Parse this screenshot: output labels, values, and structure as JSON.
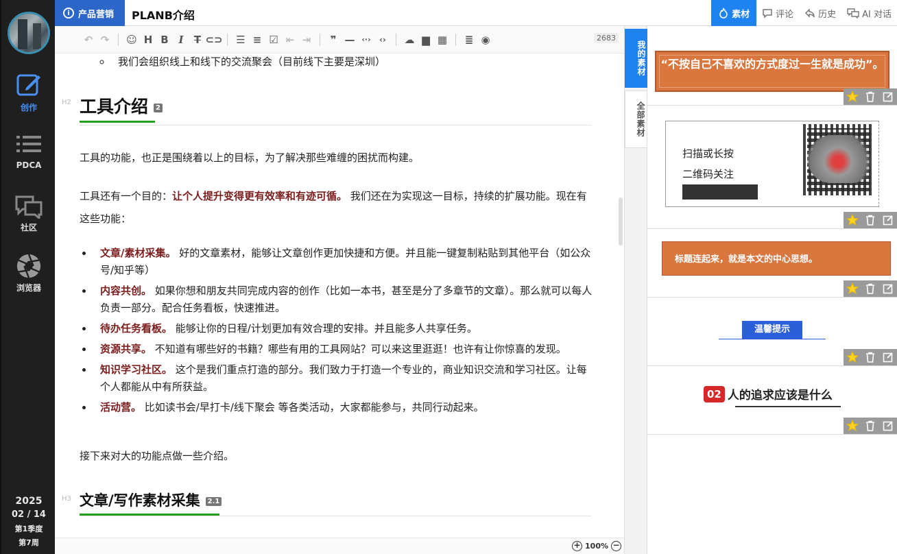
{
  "sidebar": {
    "nav": [
      {
        "label": "创作",
        "icon": "edit-icon"
      },
      {
        "label": "PDCA",
        "icon": "list-icon"
      },
      {
        "label": "社区",
        "icon": "chat-icon"
      },
      {
        "label": "浏览器",
        "icon": "aperture-icon"
      }
    ],
    "date": {
      "year": "2025",
      "month_day": "02 / 14",
      "quarter": "第1季度",
      "week": "第7周"
    }
  },
  "topbar": {
    "crumb": "产品营销",
    "title": "PLANB介绍",
    "tabs": [
      {
        "label": "素材",
        "icon": "fire-icon"
      },
      {
        "label": "评论",
        "icon": "comment-icon"
      },
      {
        "label": "历史",
        "icon": "history-icon"
      },
      {
        "label": "AI 对话",
        "icon": "ai-chat-icon"
      }
    ]
  },
  "toolbar": {
    "word_count": "2683"
  },
  "editor": {
    "top_bullet": "我们会组织线上和线下的交流聚会（目前线下主要是深圳）",
    "h2": {
      "mark": "H2",
      "title": "工具介绍",
      "num": "2"
    },
    "p1": "工具的功能，也正是围绕着以上的目标，为了解决那些难缠的困扰而构建。",
    "p2_pre": "工具还有一个目的：",
    "p2_bold": "让个人提升变得更有效率和有迹可循。",
    "p2_post": " 我们还在为实现这一目标，持续的扩展功能。现在有这些功能：",
    "features": [
      {
        "name": "文章/素材采集。",
        "desc": " 好的文章素材，能够让文章创作更加快捷和方便。并且能一键复制粘贴到其他平台（如公众号/知乎等）"
      },
      {
        "name": "内容共创。",
        "desc": " 如果你想和朋友共同完成内容的创作（比如一本书，甚至是分了多章节的文章）。那么就可以每人负责一部分。配合任务看板，快速推进。"
      },
      {
        "name": "待办任务看板。",
        "desc": " 能够让你的日程/计划更加有效合理的安排。并且能多人共享任务。"
      },
      {
        "name": "资源共享。",
        "desc": " 不知道有哪些好的书籍？哪些有用的工具网站？可以来这里逛逛！也许有让你惊喜的发现。"
      },
      {
        "name": "知识学习社区。",
        "desc": " 这个是我们重点打造的部分。我们致力于打造一个专业的，商业知识交流和学习社区。让每个人都能从中有所获益。"
      },
      {
        "name": "活动营。",
        "desc": " 比如读书会/早打卡/线下聚会 等各类活动，大家都能参与，共同行动起来。"
      }
    ],
    "p3": "接下来对大的功能点做一些介绍。",
    "h3": {
      "mark": "H3",
      "title": "文章/写作素材采集",
      "num": "2.1"
    }
  },
  "statusbar": {
    "zoom": "100%"
  },
  "side_tabs": {
    "mine": "我的素材",
    "all": "全部素材"
  },
  "materials": {
    "m1_text": "“不按自己不喜欢的方式度过一生就是成功”。",
    "m2_line1": "扫描或长按",
    "m2_line2": "二维码关注",
    "m3_text": "标题连起来，就是本文的中心思想。",
    "m4_text": "温馨提示",
    "m5_num": "02",
    "m5_text": "人的追求应该是什么"
  }
}
